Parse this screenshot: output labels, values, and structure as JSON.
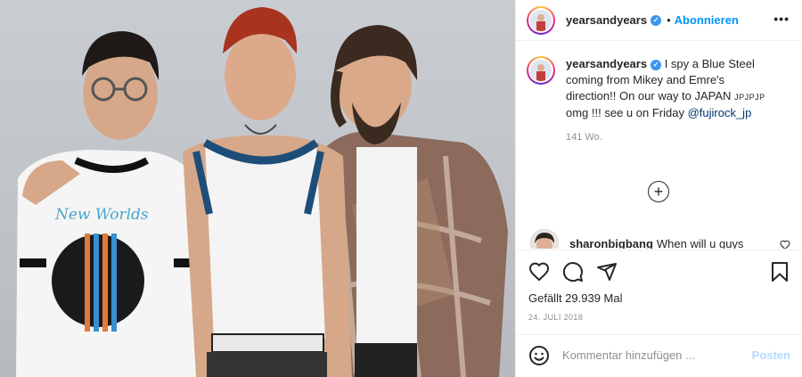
{
  "header": {
    "username": "yearsandyears",
    "separator": "•",
    "follow_label": "Abonnieren",
    "more_label": "•••"
  },
  "caption": {
    "username": "yearsandyears",
    "text_1": "I spy a Blue Steel coming from Mikey and Emre's direction!! On our way to JAPAN",
    "small_text": "JPJPJP",
    "text_2": "omg !!! see u on Friday",
    "mention": "@fujirock_jp",
    "time_ago": "141 Wo."
  },
  "load_more_label": "+",
  "comment": {
    "username": "sharonbigbang",
    "text": "When will u guys"
  },
  "photo": {
    "shirt_text": "New Worlds"
  },
  "actions": {
    "likes": "Gefällt 29.939 Mal",
    "date": "24. JULI 2018"
  },
  "comment_box": {
    "placeholder": "Kommentar hinzufügen ...",
    "post_label": "Posten"
  },
  "colors": {
    "accent": "#0095f6",
    "verified": "#3897f0",
    "post_disabled": "#b3dbff",
    "muted": "#8e8e8e"
  }
}
